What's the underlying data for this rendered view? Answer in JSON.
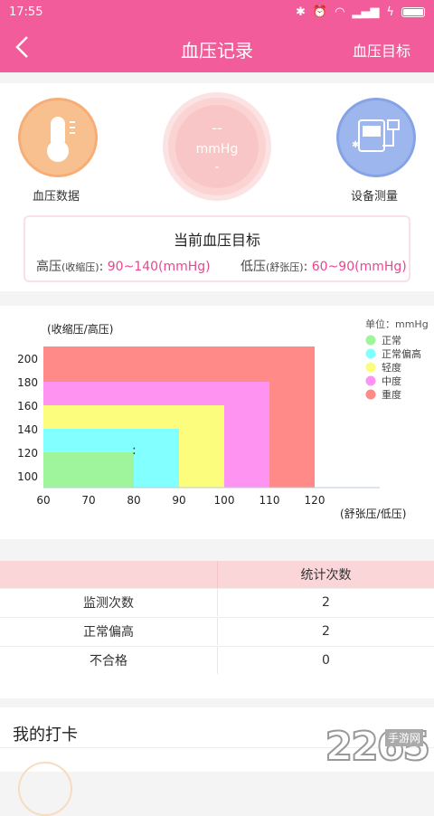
{
  "status": {
    "time": "17:55"
  },
  "header": {
    "back_icon": "chevron-left-icon",
    "title": "血压记录",
    "right_label": "血压目标"
  },
  "top": {
    "left_label": "血压数据",
    "right_label": "设备测量",
    "reading_value": "--",
    "reading_unit": "mmHg",
    "reading_bottom": "-"
  },
  "goal": {
    "title": "当前血压目标",
    "high_label": "高压",
    "high_sub": "(收缩压)",
    "high_value": "90~140(mmHg)",
    "low_label": "低压",
    "low_sub": "(舒张压)",
    "low_value": "60~90(mmHg)"
  },
  "chart_data": {
    "type": "area",
    "ylabel": "(收缩压/高压)",
    "xlabel": "(舒张压/低压)",
    "unit": "单位：mmHg",
    "x_ticks": [
      60,
      70,
      80,
      90,
      100,
      110,
      120
    ],
    "y_ticks": [
      100,
      120,
      140,
      160,
      180,
      200
    ],
    "xlim": [
      60,
      120
    ],
    "ylim": [
      90,
      210
    ],
    "zones": [
      {
        "name": "重度",
        "x_max": 120,
        "y_max": 210,
        "color": "#ff8a87"
      },
      {
        "name": "中度",
        "x_max": 110,
        "y_max": 180,
        "color": "#ff93f1"
      },
      {
        "name": "轻度",
        "x_max": 100,
        "y_max": 160,
        "color": "#fcfd7c"
      },
      {
        "name": "正常偏高",
        "x_max": 90,
        "y_max": 140,
        "color": "#82ffff"
      },
      {
        "name": "正常",
        "x_max": 80,
        "y_max": 120,
        "color": "#9ef59c"
      }
    ],
    "legend": [
      {
        "name": "正常",
        "color": "#9ef59c"
      },
      {
        "name": "正常偏高",
        "color": "#82ffff"
      },
      {
        "name": "轻度",
        "color": "#fcfd7c"
      },
      {
        "name": "中度",
        "color": "#ff93f1"
      },
      {
        "name": "重度",
        "color": "#ff8a87"
      }
    ]
  },
  "stats": {
    "header": "统计次数",
    "rows": [
      {
        "label": "监测次数",
        "value": "2"
      },
      {
        "label": "正常偏高",
        "value": "2"
      },
      {
        "label": "不合格",
        "value": "0"
      }
    ]
  },
  "checkin": {
    "title": "我的打卡"
  },
  "watermark": {
    "number": "2265",
    "suffix": "手游网"
  }
}
